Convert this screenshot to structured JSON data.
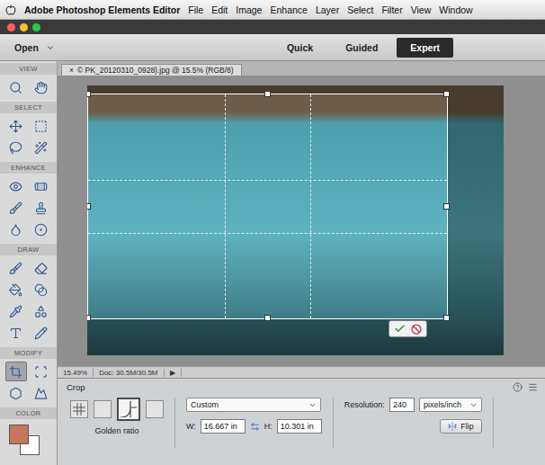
{
  "menubar": {
    "app": "Adobe Photoshop Elements Editor",
    "items": [
      "File",
      "Edit",
      "Image",
      "Enhance",
      "Layer",
      "Select",
      "Filter",
      "View",
      "Window"
    ]
  },
  "modebar": {
    "open": "Open",
    "tabs": [
      {
        "label": "Quick",
        "selected": false
      },
      {
        "label": "Guided",
        "selected": false
      },
      {
        "label": "Expert",
        "selected": true
      }
    ]
  },
  "toolbox": {
    "sections": [
      {
        "label": "VIEW",
        "tools": [
          {
            "selected": false
          },
          {
            "selected": false
          }
        ]
      },
      {
        "label": "SELECT",
        "tools": [
          {
            "selected": false
          },
          {
            "selected": false
          },
          {
            "selected": false
          },
          {
            "selected": false
          }
        ]
      },
      {
        "label": "ENHANCE",
        "tools": [
          {
            "selected": false
          },
          {
            "selected": false
          },
          {
            "selected": false
          },
          {
            "selected": false
          },
          {
            "selected": false
          },
          {
            "selected": false
          }
        ]
      },
      {
        "label": "DRAW",
        "tools": [
          {
            "selected": false
          },
          {
            "selected": false
          },
          {
            "selected": false
          },
          {
            "selected": false
          },
          {
            "selected": false
          },
          {
            "selected": false
          },
          {
            "selected": false
          },
          {
            "selected": false
          }
        ]
      },
      {
        "label": "MODIFY",
        "tools": [
          {
            "selected": true
          },
          {
            "selected": false
          },
          {
            "selected": false
          },
          {
            "selected": false
          }
        ]
      }
    ],
    "color": {
      "label": "COLOR",
      "foreground": "#c8765c",
      "background": "#ffffff"
    }
  },
  "document": {
    "close": "×",
    "title": "© PK_20120310_0928).jpg @ 15.5% (RGB/8)"
  },
  "status_bar": {
    "zoom": "15.49%",
    "doc": "Doc: 30.5M/30.5M",
    "arrow": "▶"
  },
  "options": {
    "title": "Crop",
    "presets": [
      {
        "kind": "grid",
        "selected": false
      },
      {
        "kind": "plain",
        "selected": false
      },
      {
        "kind": "golden",
        "selected": true
      },
      {
        "kind": "plain",
        "selected": false
      }
    ],
    "overlay_label": "Golden ratio",
    "ratio": "Custom",
    "width_label": "W:",
    "width": "16.667 in",
    "height_label": "H:",
    "height": "10.301 in",
    "resolution_label": "Resolution:",
    "resolution": "240",
    "resolution_unit": "pixels/inch",
    "flip": "Flip"
  }
}
